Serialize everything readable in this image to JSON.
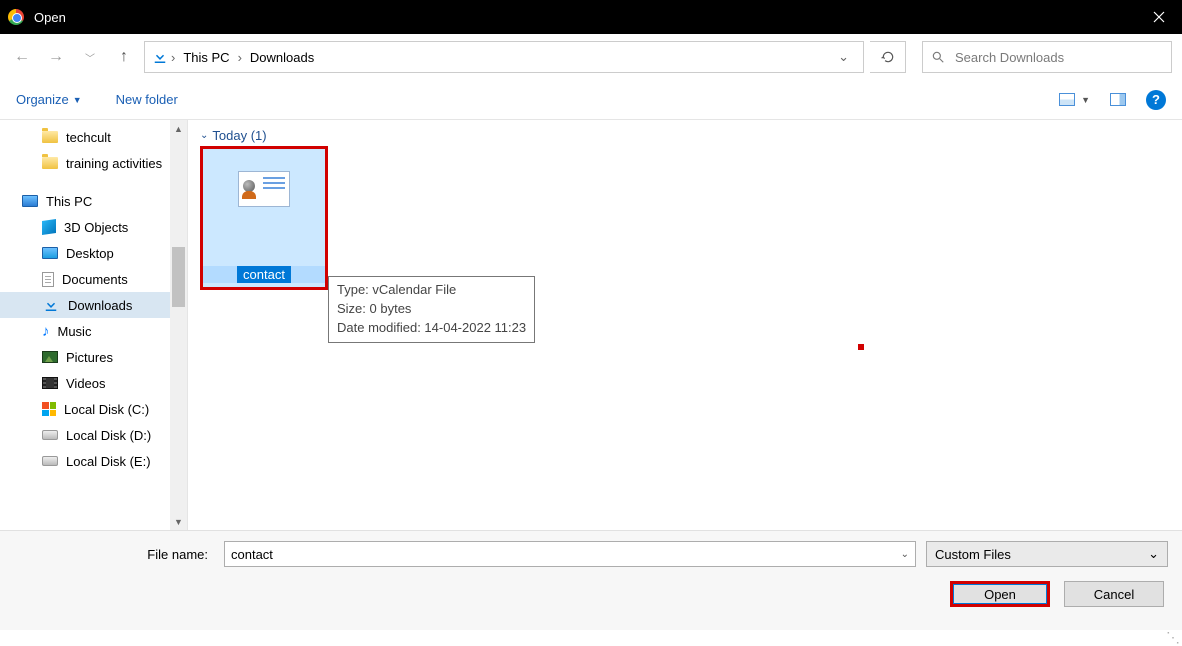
{
  "title": "Open",
  "breadcrumb": {
    "root": "This PC",
    "current": "Downloads"
  },
  "search_placeholder": "Search Downloads",
  "toolbar": {
    "organize": "Organize",
    "new_folder": "New folder"
  },
  "nav": {
    "techcult": "techcult",
    "training": "training activities",
    "thispc": "This PC",
    "objects3d": "3D Objects",
    "desktop": "Desktop",
    "documents": "Documents",
    "downloads": "Downloads",
    "music": "Music",
    "pictures": "Pictures",
    "videos": "Videos",
    "disk_c": "Local Disk (C:)",
    "disk_d": "Local Disk (D:)",
    "disk_e": "Local Disk (E:)"
  },
  "group_header": "Today (1)",
  "file": {
    "name": "contact"
  },
  "tooltip": {
    "type": "Type: vCalendar File",
    "size": "Size: 0 bytes",
    "modified": "Date modified: 14-04-2022 11:23"
  },
  "footer": {
    "label": "File name:",
    "value": "contact",
    "filter": "Custom Files",
    "open": "Open",
    "cancel": "Cancel"
  }
}
